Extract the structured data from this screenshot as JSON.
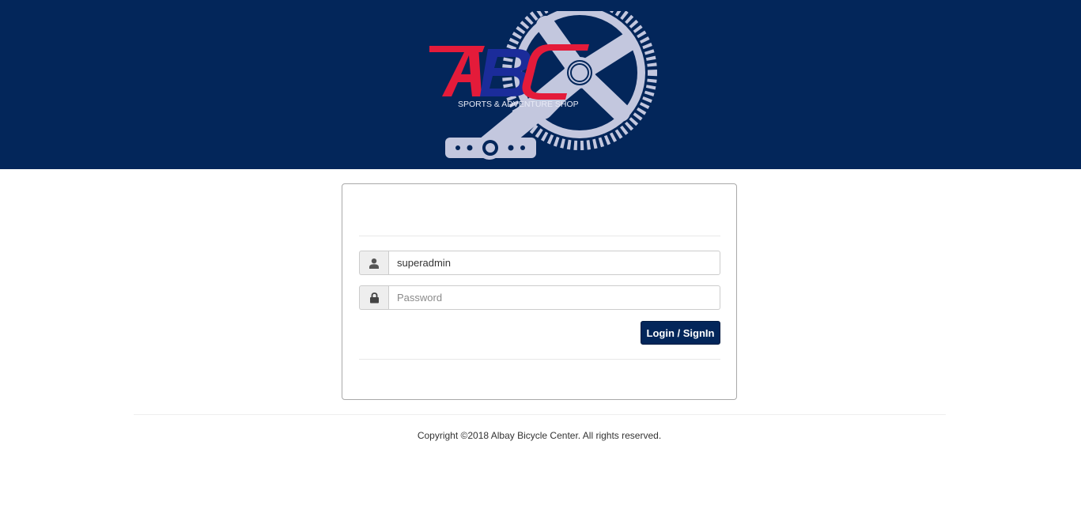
{
  "header": {
    "logo_text": "ABC",
    "logo_tagline": "SPORTS & ADVENTURE SHOP",
    "background_color": "#03265a"
  },
  "login_form": {
    "username_icon": "user-icon",
    "username_value": "superadmin",
    "password_icon": "lock-icon",
    "password_value": "",
    "password_placeholder": "Password",
    "submit_label": "Login / SignIn",
    "button_color": "#03265a"
  },
  "footer": {
    "copyright": "Copyright ©2018 Albay Bicycle Center. All rights reserved."
  }
}
